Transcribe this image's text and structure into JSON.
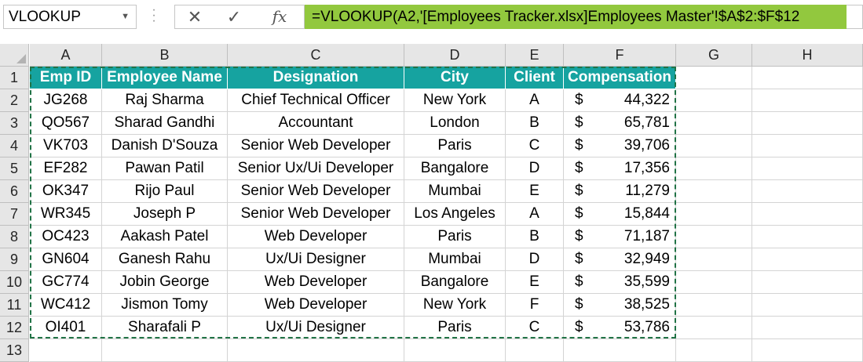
{
  "namebox": {
    "value": "VLOOKUP"
  },
  "formula_bar": {
    "cancel_icon": "✕",
    "enter_icon": "✓",
    "fx_icon": "fx",
    "formula": "=VLOOKUP(A2,'[Employees Tracker.xlsx]Employees Master'!$A$2:$F$12",
    "formula_highlight_color": "#92c83e"
  },
  "columns": [
    "A",
    "B",
    "C",
    "D",
    "E",
    "F",
    "G",
    "H"
  ],
  "rows": [
    "1",
    "2",
    "3",
    "4",
    "5",
    "6",
    "7",
    "8",
    "9",
    "10",
    "11",
    "12",
    "13"
  ],
  "table": {
    "header_color": "#16a3a0",
    "headers": [
      "Emp ID",
      "Employee Name",
      "Designation",
      "City",
      "Client",
      "Compensation"
    ],
    "currency": "$",
    "records": [
      [
        "JG268",
        "Raj Sharma",
        "Chief Technical Officer",
        "New York",
        "A",
        "44,322"
      ],
      [
        "QO567",
        "Sharad Gandhi",
        "Accountant",
        "London",
        "B",
        "65,781"
      ],
      [
        "VK703",
        "Danish D'Souza",
        "Senior Web Developer",
        "Paris",
        "C",
        "39,706"
      ],
      [
        "EF282",
        "Pawan Patil",
        "Senior Ux/Ui Developer",
        "Bangalore",
        "D",
        "17,356"
      ],
      [
        "OK347",
        "Rijo Paul",
        "Senior Web Developer",
        "Mumbai",
        "E",
        "11,279"
      ],
      [
        "WR345",
        "Joseph P",
        "Senior Web Developer",
        "Los Angeles",
        "A",
        "15,844"
      ],
      [
        "OC423",
        "Aakash Patel",
        "Web Developer",
        "Paris",
        "B",
        "71,187"
      ],
      [
        "GN604",
        "Ganesh Rahu",
        "Ux/Ui Designer",
        "Mumbai",
        "D",
        "32,949"
      ],
      [
        "GC774",
        "Jobin George",
        "Web Developer",
        "Bangalore",
        "E",
        "35,599"
      ],
      [
        "WC412",
        "Jismon Tomy",
        "Web Developer",
        "New York",
        "F",
        "38,525"
      ],
      [
        "OI401",
        "Sharafali P",
        "Ux/Ui Designer",
        "Paris",
        "C",
        "53,786"
      ]
    ]
  }
}
